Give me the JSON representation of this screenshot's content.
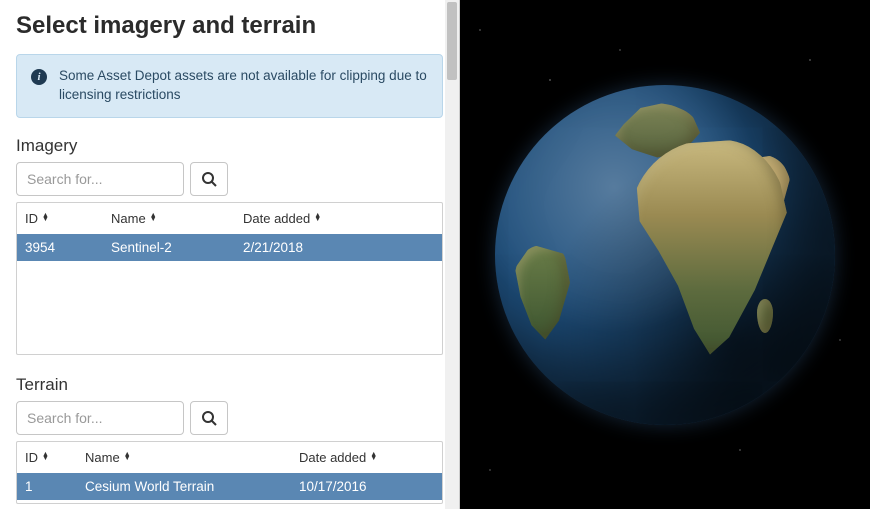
{
  "title": "Select imagery and terrain",
  "info": {
    "text": "Some Asset Depot assets are not available for clipping due to licensing restrictions"
  },
  "imagery": {
    "label": "Imagery",
    "search_placeholder": "Search for...",
    "columns": {
      "id": "ID",
      "name": "Name",
      "date": "Date added"
    },
    "rows": [
      {
        "id": "3954",
        "name": "Sentinel-2",
        "date": "2/21/2018",
        "selected": true
      }
    ]
  },
  "terrain": {
    "label": "Terrain",
    "search_placeholder": "Search for...",
    "columns": {
      "id": "ID",
      "name": "Name",
      "date": "Date added"
    },
    "rows": [
      {
        "id": "1",
        "name": "Cesium World Terrain",
        "date": "10/17/2016",
        "selected": true
      }
    ]
  }
}
